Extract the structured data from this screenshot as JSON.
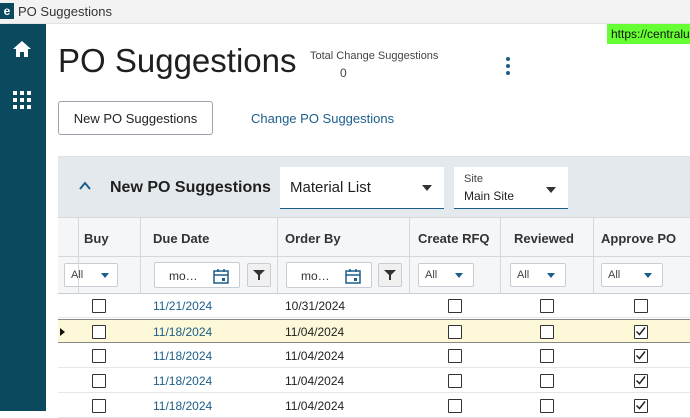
{
  "window": {
    "title": "PO Suggestions",
    "logo_text": "e"
  },
  "url_badge": "https://centralu",
  "nav": [
    {
      "icon": "home-icon"
    },
    {
      "icon": "apps-grid-icon"
    }
  ],
  "page": {
    "title": "PO Suggestions",
    "total_change_label": "Total Change Suggestions",
    "total_change_value": "0"
  },
  "actions": {
    "new_button": "New PO Suggestions",
    "change_link": "Change PO Suggestions"
  },
  "panel": {
    "title": "New PO Suggestions",
    "view_dropdown": "Material List",
    "site_label": "Site",
    "site_value": "Main Site"
  },
  "grid": {
    "columns": [
      "Buy",
      "Due Date",
      "Order By",
      "Create RFQ",
      "Reviewed",
      "Approve PO"
    ],
    "filters": {
      "all": "All",
      "date_placeholder": "mo…"
    },
    "rows": [
      {
        "buy": false,
        "due": "11/21/2024",
        "order_by": "10/31/2024",
        "rfq": false,
        "reviewed": false,
        "approve": false,
        "selected": false
      },
      {
        "buy": false,
        "due": "11/18/2024",
        "order_by": "11/04/2024",
        "rfq": false,
        "reviewed": false,
        "approve": true,
        "selected": true
      },
      {
        "buy": false,
        "due": "11/18/2024",
        "order_by": "11/04/2024",
        "rfq": false,
        "reviewed": false,
        "approve": true,
        "selected": false
      },
      {
        "buy": false,
        "due": "11/18/2024",
        "order_by": "11/04/2024",
        "rfq": false,
        "reviewed": false,
        "approve": true,
        "selected": false
      },
      {
        "buy": false,
        "due": "11/18/2024",
        "order_by": "11/04/2024",
        "rfq": false,
        "reviewed": false,
        "approve": true,
        "selected": false
      }
    ]
  }
}
